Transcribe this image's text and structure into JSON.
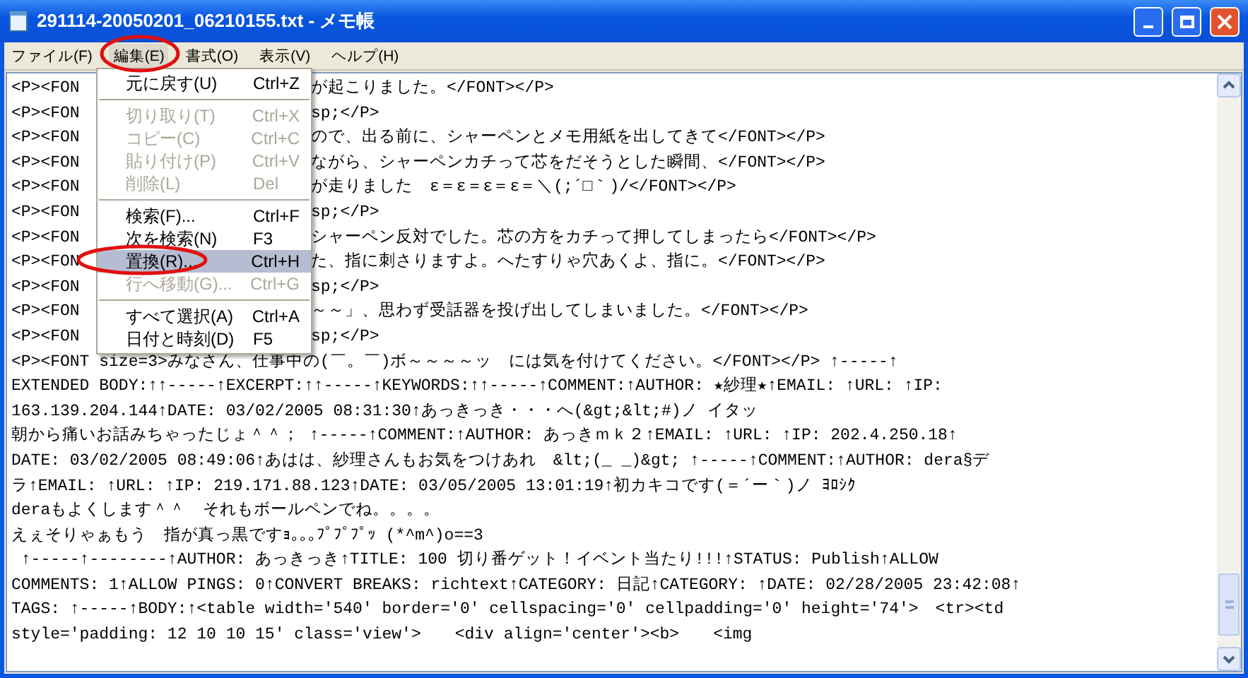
{
  "window": {
    "title": "291114-20050201_06210155.txt - メモ帳"
  },
  "menubar": [
    {
      "label": "ファイル(F)",
      "selected": false
    },
    {
      "label": "編集(E)",
      "selected": true
    },
    {
      "label": "書式(O)",
      "selected": false
    },
    {
      "label": "表示(V)",
      "selected": false
    },
    {
      "label": "ヘルプ(H)",
      "selected": false
    }
  ],
  "edit_menu": [
    {
      "kind": "item",
      "label": "元に戻す(U)",
      "shortcut": "Ctrl+Z",
      "disabled": false,
      "selected": false
    },
    {
      "kind": "separator"
    },
    {
      "kind": "item",
      "label": "切り取り(T)",
      "shortcut": "Ctrl+X",
      "disabled": true,
      "selected": false
    },
    {
      "kind": "item",
      "label": "コピー(C)",
      "shortcut": "Ctrl+C",
      "disabled": true,
      "selected": false
    },
    {
      "kind": "item",
      "label": "貼り付け(P)",
      "shortcut": "Ctrl+V",
      "disabled": true,
      "selected": false
    },
    {
      "kind": "item",
      "label": "削除(L)",
      "shortcut": "Del",
      "disabled": true,
      "selected": false
    },
    {
      "kind": "separator"
    },
    {
      "kind": "item",
      "label": "検索(F)...",
      "shortcut": "Ctrl+F",
      "disabled": false,
      "selected": false
    },
    {
      "kind": "item",
      "label": "次を検索(N)",
      "shortcut": "F3",
      "disabled": false,
      "selected": false
    },
    {
      "kind": "item",
      "label": "置換(R)...",
      "shortcut": "Ctrl+H",
      "disabled": false,
      "selected": true
    },
    {
      "kind": "item",
      "label": "行へ移動(G)...",
      "shortcut": "Ctrl+G",
      "disabled": true,
      "selected": false
    },
    {
      "kind": "separator"
    },
    {
      "kind": "item",
      "label": "すべて選択(A)",
      "shortcut": "Ctrl+A",
      "disabled": false,
      "selected": false
    },
    {
      "kind": "item",
      "label": "日付と時刻(D)",
      "shortcut": "F5",
      "disabled": false,
      "selected": false
    }
  ],
  "editor_lines": [
    {
      "left": "<P><FON",
      "right": "が起こりました。</FONT></P>"
    },
    {
      "left": "<P><FON",
      "right": "sp;</P>"
    },
    {
      "left": "<P><FON",
      "right": "ので、出る前に、シャーペンとメモ用紙を出してきて</FONT></P>"
    },
    {
      "left": "<P><FON",
      "right": "ながら、シャーペンカチって芯をだそうとした瞬間、</FONT></P>"
    },
    {
      "left": "<P><FON",
      "right": "が走りました　ε＝ε＝ε＝ε＝＼(;´□｀)/</FONT></P>"
    },
    {
      "left": "<P><FON",
      "right": "sp;</P>"
    },
    {
      "left": "<P><FON",
      "right": "シャーペン反対でした。芯の方をカチって押してしまったら</FONT></P>"
    },
    {
      "left": "<P><FON",
      "right": "た、指に刺さりますよ。へたすりゃ穴あくよ、指に。</FONT></P>"
    },
    {
      "left": "<P><FON",
      "right": "sp;</P>"
    },
    {
      "left": "<P><FON",
      "right": "～～」、思わず受話器を投げ出してしまいました。</FONT></P>"
    },
    {
      "left": "<P><FON",
      "right": "sp;</P>"
    },
    {
      "text": "<P><FONT size=3>みなさん、仕事中の(￣。￣)ボ～～～～ッ　には気を付けてください。</FONT></P> ↑-----↑"
    },
    {
      "text": "EXTENDED BODY:↑↑-----↑EXCERPT:↑↑-----↑KEYWORDS:↑↑-----↑COMMENT:↑AUTHOR: ★紗理★↑EMAIL: ↑URL: ↑IP:"
    },
    {
      "text": "163.139.204.144↑DATE: 03/02/2005 08:31:30↑あっきっき・・・へ(&gt;&lt;#)ノ イタッ"
    },
    {
      "text": "朝から痛いお話みちゃったじょ＾＾； ↑-----↑COMMENT:↑AUTHOR: あっきｍｋ２↑EMAIL: ↑URL: ↑IP: 202.4.250.18↑"
    },
    {
      "text": "DATE: 03/02/2005 08:49:06↑あはは、紗理さんもお気をつけあれ　&lt;(_ _)&gt; ↑-----↑COMMENT:↑AUTHOR: dera§デ"
    },
    {
      "text": "ラ↑EMAIL: ↑URL: ↑IP: 219.171.88.123↑DATE: 03/05/2005 13:01:19↑初カキコです(＝´ー｀)ノ ﾖﾛｼｸ"
    },
    {
      "text": "deraもよくします＾＾　それもボールペンでね。。。。"
    },
    {
      "text": "えぇそりゃぁもう　指が真っ黒ですｮ｡｡｡ﾌﾟﾌﾟﾌﾟｯ (*^m^)o==3"
    },
    {
      "text": " ↑-----↑--------↑AUTHOR: あっきっき↑TITLE: 100 切り番ゲット！イベント当たり!!!↑STATUS: Publish↑ALLOW"
    },
    {
      "text": "COMMENTS: 1↑ALLOW PINGS: 0↑CONVERT BREAKS: richtext↑CATEGORY: 日記↑CATEGORY: ↑DATE: 02/28/2005 23:42:08↑"
    },
    {
      "text": "TAGS: ↑-----↑BODY:↑<table width='540' border='0' cellspacing='0' cellpadding='0' height='74'>　<tr><td"
    },
    {
      "text": "style='padding: 12 10 10 15' class='view'>　　<div align='center'><b>　　<img"
    }
  ]
}
